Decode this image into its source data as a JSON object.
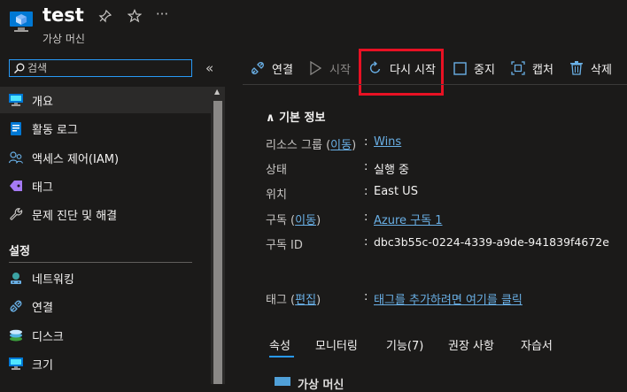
{
  "header": {
    "title": "test",
    "subtitle": "가상 머신",
    "more": "···"
  },
  "search": {
    "placeholder": "검색"
  },
  "sidebar": {
    "collapse": "«",
    "items": [
      {
        "label": "개요",
        "icon": "monitor-icon"
      },
      {
        "label": "활동 로그",
        "icon": "log-icon"
      },
      {
        "label": "액세스 제어(IAM)",
        "icon": "people-icon"
      },
      {
        "label": "태그",
        "icon": "tag-icon"
      },
      {
        "label": "문제 진단 및 해결",
        "icon": "wrench-icon"
      }
    ],
    "section_settings": "설정",
    "settings_items": [
      {
        "label": "네트워킹",
        "icon": "network-icon"
      },
      {
        "label": "연결",
        "icon": "connect-icon"
      },
      {
        "label": "디스크",
        "icon": "disk-icon"
      },
      {
        "label": "크기",
        "icon": "size-icon"
      }
    ]
  },
  "toolbar": {
    "connect": "연결",
    "start": "시작",
    "restart": "다시 시작",
    "stop": "중지",
    "capture": "캡처",
    "delete": "삭제"
  },
  "essentials": {
    "toggle": "∧ 기본 정보",
    "rows": [
      {
        "label": "리소스 그룹",
        "link_label": "이동",
        "value": "Wins"
      },
      {
        "label": "상태",
        "value": "실행 중"
      },
      {
        "label": "위치",
        "value": "East US"
      },
      {
        "label": "구독",
        "link_label": "이동",
        "value": "Azure 구독 1"
      },
      {
        "label": "구독 ID",
        "value": "dbc3b55c-0224-4339-a9de-941839f4672e"
      }
    ],
    "tags": {
      "label": "태그",
      "link_label": "편집",
      "value": "태그를 추가하려면 여기를 클릭"
    },
    "separator": ":"
  },
  "tabs": [
    "속성",
    "모니터링",
    "기능(7)",
    "권장 사항",
    "자습서"
  ],
  "bottom_peek": "가상 머신",
  "colors": {
    "accent": "#2899f5",
    "link": "#69afe5",
    "highlight": "#e81123"
  }
}
